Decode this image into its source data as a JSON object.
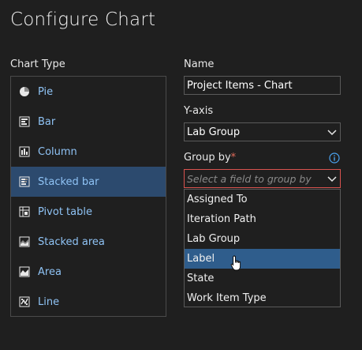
{
  "dialog": {
    "title": "Configure Chart"
  },
  "chart_type": {
    "label": "Chart Type",
    "items": [
      {
        "label": "Pie",
        "icon": "pie-icon"
      },
      {
        "label": "Bar",
        "icon": "bar-chart-icon"
      },
      {
        "label": "Column",
        "icon": "column-chart-icon"
      },
      {
        "label": "Stacked bar",
        "icon": "stacked-bar-icon",
        "selected": true
      },
      {
        "label": "Pivot table",
        "icon": "pivot-table-icon"
      },
      {
        "label": "Stacked area",
        "icon": "stacked-area-icon"
      },
      {
        "label": "Area",
        "icon": "area-chart-icon"
      },
      {
        "label": "Line",
        "icon": "line-chart-icon"
      }
    ]
  },
  "name": {
    "label": "Name",
    "value": "Project Items - Chart"
  },
  "y_axis": {
    "label": "Y-axis",
    "value": "Lab Group"
  },
  "group_by": {
    "label": "Group by",
    "required_mark": "*",
    "placeholder": "Select a field to group by",
    "options": [
      "Assigned To",
      "Iteration Path",
      "Lab Group",
      "Label",
      "State",
      "Work Item Type"
    ],
    "hovered": "Label"
  },
  "colors": {
    "background": "#1f1f1f",
    "accent": "#8fc3f5",
    "selected": "#2c4a6e",
    "hover": "#2f5d8c",
    "error_border": "#d9534f"
  }
}
